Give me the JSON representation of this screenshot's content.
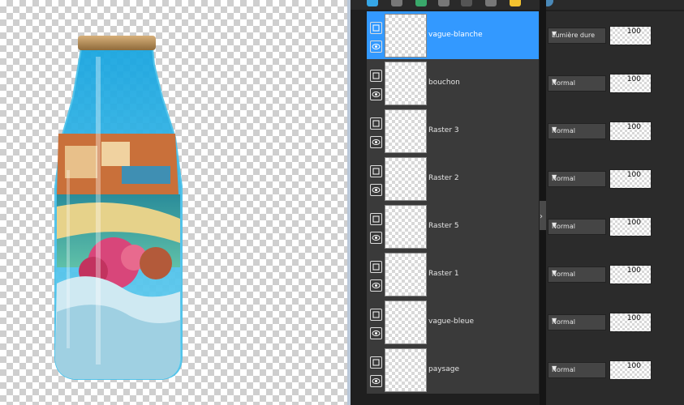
{
  "layers": [
    {
      "name": "vague-blanche",
      "blend_mode": "Lumière dure",
      "opacity": "100",
      "selected": true
    },
    {
      "name": "bouchon",
      "blend_mode": "Normal",
      "opacity": "100",
      "selected": false
    },
    {
      "name": "Raster 3",
      "blend_mode": "Normal",
      "opacity": "100",
      "selected": false
    },
    {
      "name": "Raster 2",
      "blend_mode": "Normal",
      "opacity": "100",
      "selected": false
    },
    {
      "name": "Raster 5",
      "blend_mode": "Normal",
      "opacity": "100",
      "selected": false
    },
    {
      "name": "Raster 1",
      "blend_mode": "Normal",
      "opacity": "100",
      "selected": false
    },
    {
      "name": "vague-bleue",
      "blend_mode": "Normal",
      "opacity": "100",
      "selected": false
    },
    {
      "name": "paysage",
      "blend_mode": "Normal",
      "opacity": "100",
      "selected": false
    }
  ],
  "colors": {
    "selection": "#3399ff",
    "panel": "#3a3a3a"
  }
}
